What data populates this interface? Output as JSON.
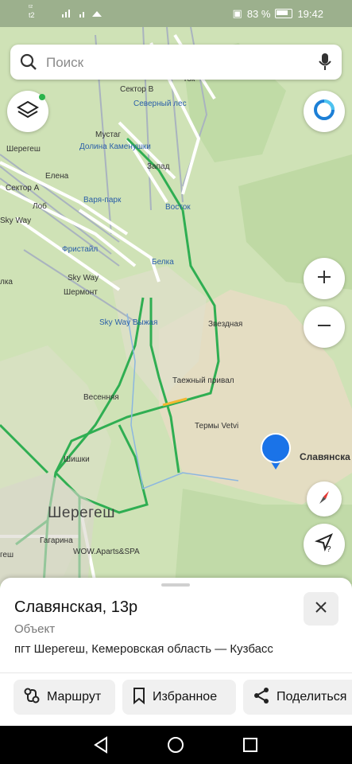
{
  "status_bar": {
    "sim1": "ᵗ²",
    "sim2": "t2",
    "battery": "83 %",
    "time": "19:42"
  },
  "search": {
    "placeholder": "Поиск"
  },
  "map": {
    "labels": {
      "sector_v": "Сектор В",
      "severny_les": "Северный лес",
      "mustag": "Мустаг",
      "dolina": "Долина Каменушки",
      "sheregesh_small": "Шерегеш",
      "sector_a": "Сектор А",
      "elena": "Елена",
      "varya_park": "Варя-парк",
      "zapad": "Запад",
      "vostok": "Восток",
      "lob": "Лоб",
      "sky_way1": "Sky Way",
      "fristail": "Фристайл",
      "belka": "Белка",
      "sky_way2": "Sky Way",
      "shermont": "Шермонт",
      "elka": "лка",
      "sky_way_vyzhaya": "Sky Way Выжая",
      "zvezdnaya": "Звездная",
      "taezhny": "Таежный привал",
      "vesennyaya": "Весенняя",
      "termy": "Термы Vetvi",
      "slavyanska": "Славянска",
      "shishki": "Шишки",
      "sheregesh_big": "Шерегеш",
      "gagarina": "Гагарина",
      "wow": "WOW.Aparts&SPA",
      "geshi": "геш",
      "tok": "Ток"
    }
  },
  "place": {
    "title": "Славянская, 13р",
    "type": "Объект",
    "address": "пгт Шерегеш, Кемеровская область — Кузбасс"
  },
  "actions": {
    "route": "Маршрут",
    "favorites": "Избранное",
    "share": "Поделиться"
  }
}
